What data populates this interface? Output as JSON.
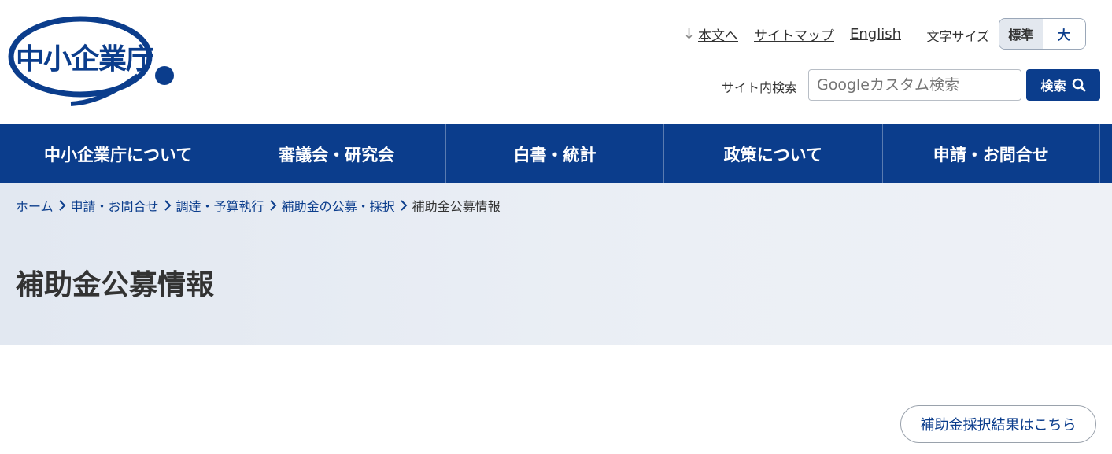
{
  "header": {
    "logo_text": "中小企業庁",
    "utility_links": {
      "skip": "本文へ",
      "sitemap": "サイトマップ",
      "english": "English"
    },
    "font_size": {
      "label": "文字サイズ",
      "standard": "標準",
      "large": "大"
    },
    "search": {
      "label": "サイト内検索",
      "placeholder": "Googleカスタム検索",
      "button": "検索"
    }
  },
  "nav": {
    "items": [
      {
        "label": "中小企業庁について"
      },
      {
        "label": "審議会・研究会"
      },
      {
        "label": "白書・統計"
      },
      {
        "label": "政策について"
      },
      {
        "label": "申請・お問合せ"
      }
    ]
  },
  "breadcrumb": {
    "items": [
      "ホーム",
      "申請・お問合せ",
      "調達・予算執行",
      "補助金の公募・採択"
    ],
    "current": "補助金公募情報"
  },
  "page": {
    "title": "補助金公募情報",
    "result_button": "補助金採択結果はこちら"
  },
  "colors": {
    "brand": "#0b3d8c"
  }
}
